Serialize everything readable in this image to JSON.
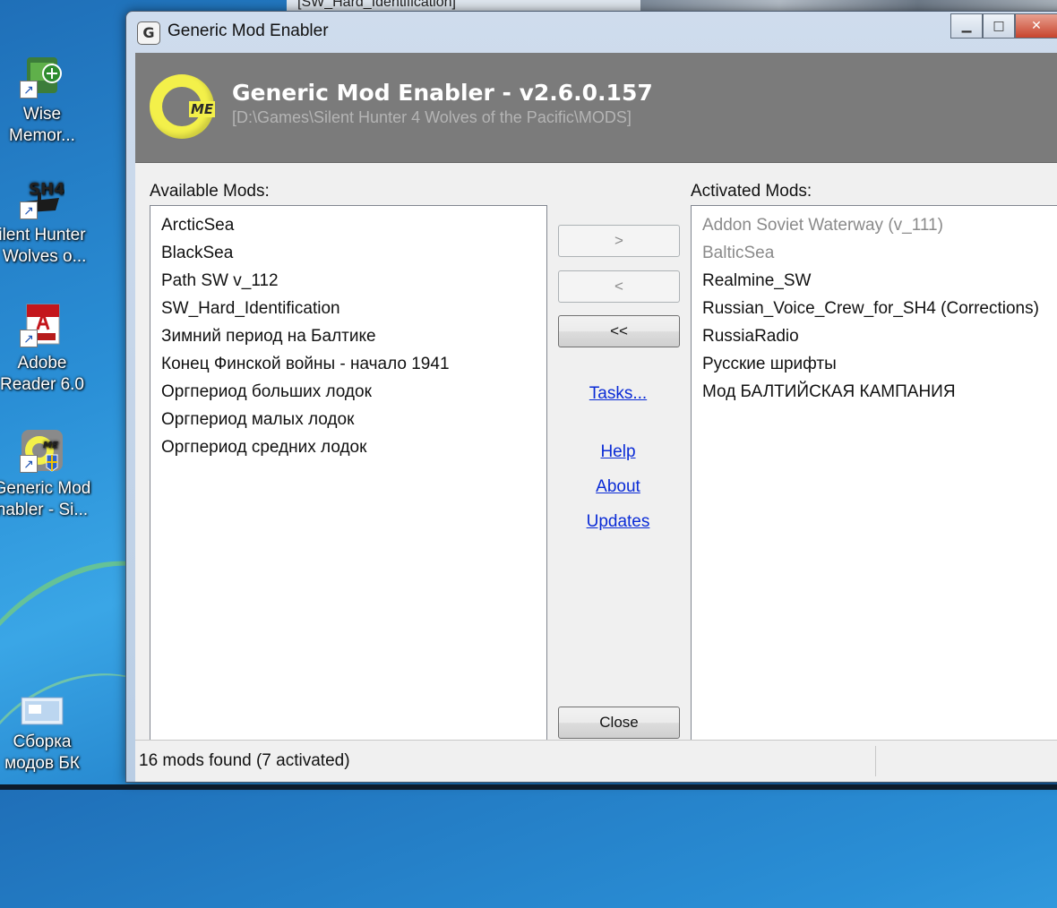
{
  "desktop": {
    "background_window_title": "[SW_Hard_Identification]",
    "icons": [
      {
        "label": "Wise\nMemor...",
        "icon": "wise-memory-icon"
      },
      {
        "label": "ilent Hunter\n Wolves o...",
        "icon": "silent-hunter-icon",
        "badge": "SH4"
      },
      {
        "label": "Adobe\nReader 6.0",
        "icon": "adobe-reader-icon"
      },
      {
        "label": "Generic Mod\nnabler - Si...",
        "icon": "gme-shortcut-icon"
      },
      {
        "label": "Сборка\nмодов БК",
        "icon": "folder-image-icon"
      }
    ]
  },
  "window": {
    "title": "Generic Mod Enabler",
    "title_icon": "G",
    "controls": {
      "minimize": "▁",
      "maximize": "□",
      "close": "✕"
    }
  },
  "banner": {
    "title": "Generic Mod Enabler - v2.6.0.157",
    "path": "[D:\\Games\\Silent Hunter 4 Wolves of the Pacific\\MODS]",
    "logo_text": "G",
    "logo_sub": "ME"
  },
  "available": {
    "label": "Available Mods:",
    "items": [
      "ArcticSea",
      "BlackSea",
      "Path SW v_112",
      "SW_Hard_Identification",
      "Зимний период на Балтике",
      "Конец Финской войны - начало 1941",
      "Оргпериод больших лодок",
      "Оргпериод малых лодок",
      "Оргпериод средних лодок"
    ]
  },
  "activated": {
    "label": "Activated Mods:",
    "items": [
      {
        "name": "Addon Soviet Waterway (v_111)",
        "dimmed": true
      },
      {
        "name": "BalticSea",
        "dimmed": true
      },
      {
        "name": "Realmine_SW",
        "dimmed": false
      },
      {
        "name": "Russian_Voice_Crew_for_SH4 (Corrections)",
        "dimmed": false
      },
      {
        "name": "RussiaRadio",
        "dimmed": false
      },
      {
        "name": "Русские шрифты",
        "dimmed": false
      },
      {
        "name": "Мод БАЛТИЙСКАЯ КАМПАНИЯ",
        "dimmed": false
      }
    ]
  },
  "buttons": {
    "activate": ">",
    "deactivate": "<",
    "deactivate_all": "<<",
    "close": "Close"
  },
  "links": {
    "tasks": "Tasks...",
    "help": "Help",
    "about": "About",
    "updates": "Updates"
  },
  "status": {
    "text": "16 mods found (7 activated)"
  },
  "colors": {
    "banner_bg": "#7b7b7b",
    "logo_yellow": "#f3f04a",
    "link_blue": "#0a2bd6",
    "dimmed_text": "#8a8a8a"
  }
}
